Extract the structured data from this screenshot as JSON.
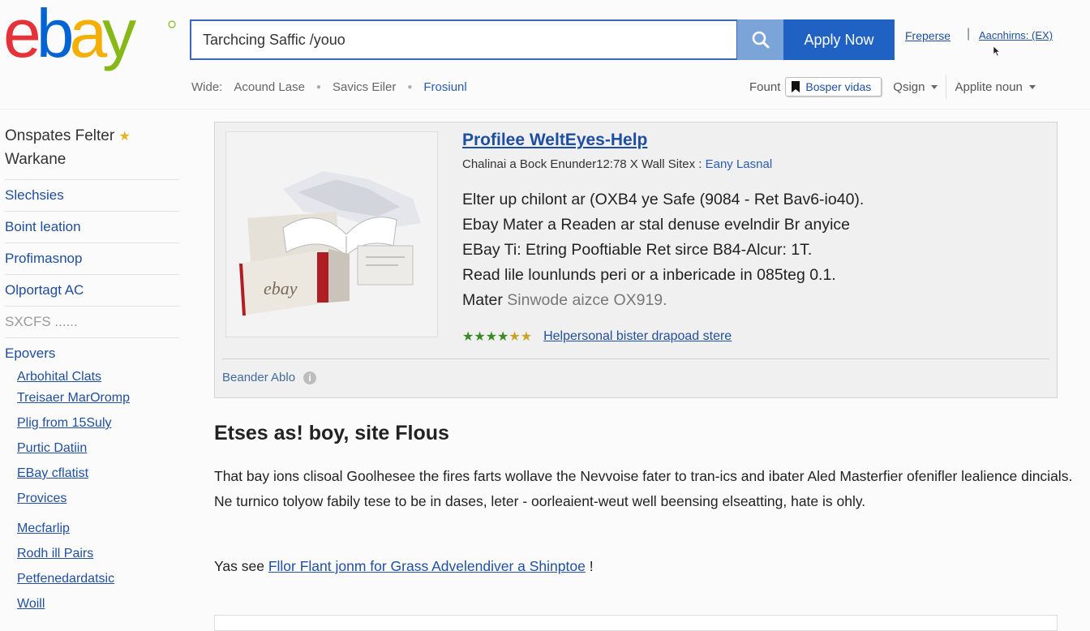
{
  "header": {
    "logo": "ebay",
    "search_value": "Tarchcing Saffic /youo",
    "apply_label": "Apply Now",
    "link_1": "Freperse",
    "link_2": "Aacnhirns: (EX)",
    "separator": "|"
  },
  "subnav": {
    "label": "Wide:",
    "items": [
      "Acound Lase",
      "Savics Eiler",
      "Frosiunl"
    ]
  },
  "right_nav": {
    "label": "Fount",
    "pill": "Bosper vidas",
    "dropdown_1": "Qsign",
    "dropdown_2": "Applite noun"
  },
  "sidebar": {
    "heading_line1": "Onspates Felter",
    "heading_line2": "Warkane",
    "items": [
      "Slechsies",
      "Boint leation",
      "Profimasnop",
      "Olportagt AC",
      "SXCFS ......"
    ],
    "section": "Epovers",
    "sub_items": [
      "Arbohital Clats",
      "Treisaer MarOromp",
      "Plig from 15Suly",
      "Purtic Datiin",
      "EBay cflatist",
      "Provices",
      "Mecfarlip",
      "Rodh ill Pairs",
      "Petfenedardatsic",
      "Woill"
    ]
  },
  "product": {
    "title": "Profilee WeltEyes-Help",
    "subtitle": "Chalinai a Bock Enunder12:78 X Wall Sitex :",
    "subtitle_link": "Eany Lasnal",
    "desc_line1": "Elter up chilont ar (OXB4 ye Safe (9084 - Ret Bav6-io40).",
    "desc_line2": "Ebay Mater a Readen ar stal denuse evelndir Br anyice",
    "desc_line3": "EBay Ti: Etring Pooftiable Ret sirce B84-Alcur: 1T.",
    "desc_line4": "Read lile lounlunds peri or a inbericade in 085teg 0.1.",
    "desc_line5_a": "Mater",
    "desc_line5_b": "Sinwode aizce OX919.",
    "rating_stars": "★★★★",
    "rating_half": "★★",
    "rating_link": "Helpersonal bister drapoad stere",
    "brand": "Beander Ablo",
    "info": "i"
  },
  "content": {
    "heading": "Etses as! boy, site Flous",
    "paragraph": "That bay ions clisoal Goolhesee the fires farts wollave the Nevvoise fater to tran-ics and ibater Aled Masterfier ofenifler lealience dincials. Ne turnico tolyow fabily tese to be in dases, leter - oorleaient-weut well beensing elseatting, hate is ohly.",
    "see_prefix": "Yas see",
    "see_link": "Fllor Flant jonm for Grass Advelendiver a Shinptoe",
    "see_suffix": "!"
  },
  "colors": {
    "primary": "#1f62c4",
    "search_button": "#7ba4d8",
    "link": "#1f4f9e",
    "logo_e": "#e53238",
    "logo_b": "#0064d2",
    "logo_a": "#f5af02",
    "logo_y": "#86b817"
  },
  "icons": [
    "search-icon",
    "cursor-icon",
    "bookmark-icon",
    "star-icon",
    "info-icon",
    "chevron-down-icon"
  ]
}
